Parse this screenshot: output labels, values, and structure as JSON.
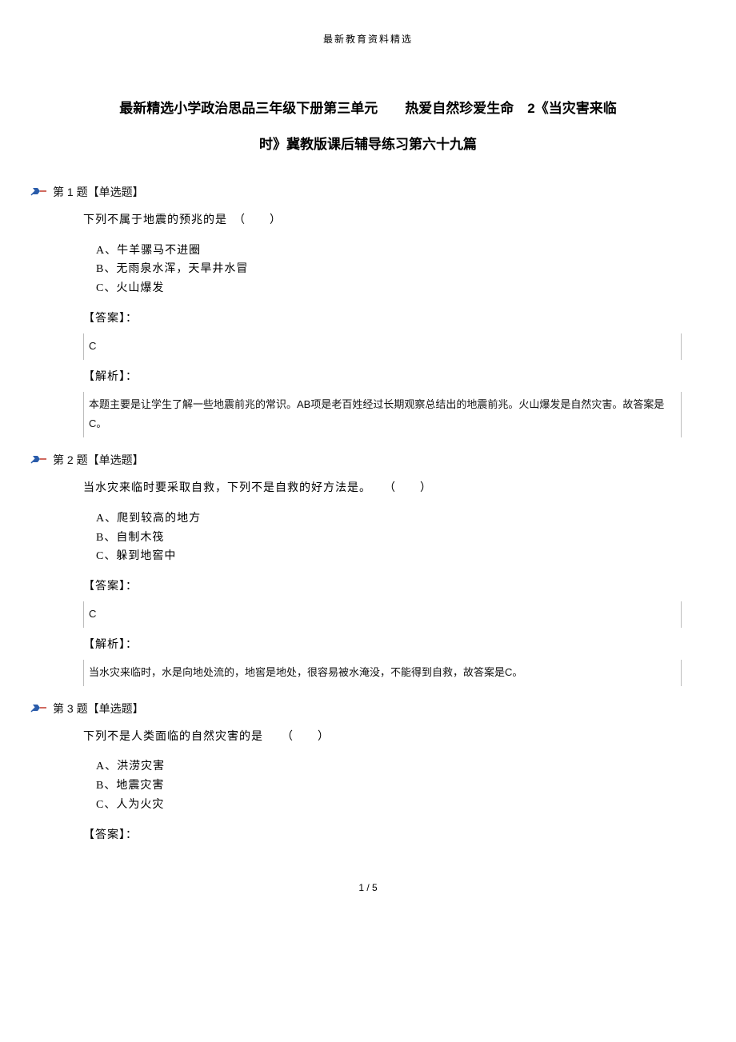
{
  "header": "最新教育资料精选",
  "title_line1": "最新精选小学政治思品三年级下册第三单元　　热爱自然珍爱生命　2《当灾害来临",
  "title_line2": "时》冀教版课后辅导练习第六十九篇",
  "questions": [
    {
      "header": "第 1 题【单选题】",
      "stem": "下列不属于地震的预兆的是　（　　）",
      "options": [
        "A、牛羊骡马不进圈",
        "B、无雨泉水浑，天旱井水冒",
        "C、火山爆发"
      ],
      "answer_label": "【答案】：",
      "answer_val": "C",
      "analysis_label": "【解析】：",
      "analysis_val": "本题主要是让学生了解一些地震前兆的常识。AB项是老百姓经过长期观察总结出的地震前兆。火山爆发是自然灾害。故答案是C。"
    },
    {
      "header": "第 2 题【单选题】",
      "stem": "当水灾来临时要采取自救，下列不是自救的好方法是。　　（　　）",
      "options": [
        "A、爬到较高的地方",
        "B、自制木筏",
        "C、躲到地窖中"
      ],
      "answer_label": "【答案】：",
      "answer_val": "C",
      "analysis_label": "【解析】：",
      "analysis_val": "当水灾来临时，水是向地处流的，地窖是地处，很容易被水淹没，不能得到自救，故答案是C。"
    },
    {
      "header": "第 3 题【单选题】",
      "stem": "下列不是人类面临的自然灾害的是　　（　　）",
      "options": [
        "A、洪涝灾害",
        "B、地震灾害",
        "C、人为火灾"
      ],
      "answer_label": "【答案】：",
      "answer_val": "",
      "analysis_label": "",
      "analysis_val": ""
    }
  ],
  "footer": "1 / 5"
}
